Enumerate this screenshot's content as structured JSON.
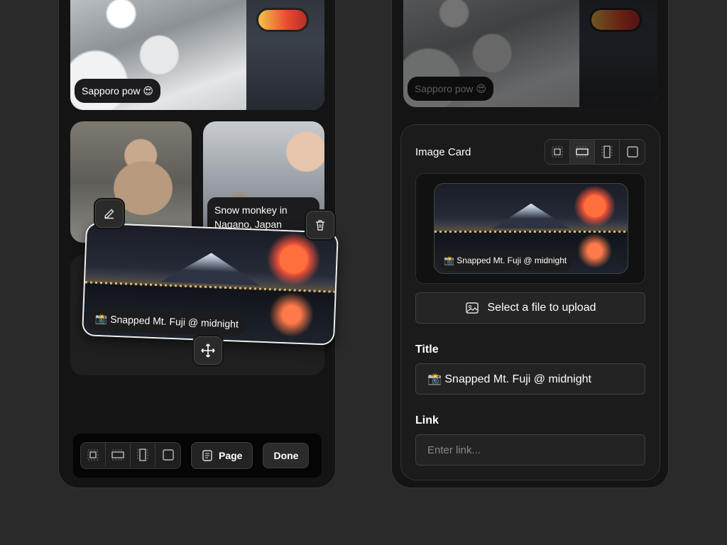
{
  "left": {
    "card_top_caption": "Sapporo pow 😍",
    "card_right_caption": "Snow monkey in Nagano, Japan",
    "dragged_caption": "📸 Snapped Mt. Fuji @ midnight",
    "toolbar": {
      "page_label": "Page",
      "done_label": "Done"
    }
  },
  "right": {
    "top_caption": "Sapporo pow 😍",
    "panel_title": "Image Card",
    "preview_caption": "📸 Snapped Mt. Fuji @ midnight",
    "upload_label": "Select a file to upload",
    "title_label": "Title",
    "title_value": "📸 Snapped Mt. Fuji @ midnight",
    "link_label": "Link",
    "link_placeholder": "Enter link..."
  },
  "icons": {
    "edit": "pencil-icon",
    "delete": "trash-icon",
    "move": "move-icon",
    "size_small": "size-small-icon",
    "size_wide": "size-wide-icon",
    "size_tall": "size-tall-icon",
    "size_large": "size-large-icon",
    "page": "page-icon",
    "image": "image-icon"
  }
}
